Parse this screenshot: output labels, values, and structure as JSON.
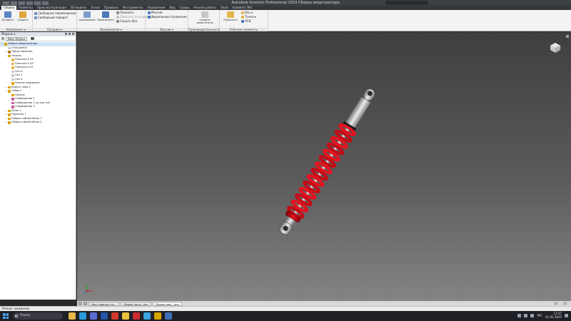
{
  "window": {
    "title": "Autodesk Inventor Professional 2019   Сборка амортизатора"
  },
  "ribbon_tabs": [
    {
      "label": "Сборка",
      "active": true
    },
    {
      "label": "Разметка"
    },
    {
      "label": "Пров.эксплуатация"
    },
    {
      "label": "3D-модель"
    },
    {
      "label": "Эскиз"
    },
    {
      "label": "Проверка"
    },
    {
      "label": "Инструменты"
    },
    {
      "label": "Управление"
    },
    {
      "label": "Вид"
    },
    {
      "label": "Среды"
    },
    {
      "label": "Начало работы"
    },
    {
      "label": "Vault"
    },
    {
      "label": "Autodesk 360"
    }
  ],
  "ribbon": {
    "groups": [
      {
        "label": "Компонент ▾"
      },
      {
        "label": "Позиция ▾"
      },
      {
        "label": "Взаимосвязи ▾"
      },
      {
        "label": "Массив ▾"
      },
      {
        "label": "Производительность"
      },
      {
        "label": "Рабочие элементы"
      }
    ],
    "insert": "Вставить",
    "create": "Создать",
    "free_move": "Свободное перемещение",
    "free_rotate": "Свободный поворот",
    "assemble": "Сопряжение",
    "constrain": "Зависимость",
    "show": "Показать",
    "show_all": "Показать Ассоциацию",
    "hide_all": "Скрыть Все",
    "pattern": "Массив",
    "mirror": "Зеркальное отражение",
    "create_subst": "Создать заместитель",
    "plane": "Плоскость",
    "axis": "Ось ▾",
    "point": "Точка ▾",
    "ucs": "ПСК"
  },
  "browser": {
    "title": "Модель ▾",
    "view_selector": "Вид сборки",
    "tree": [
      {
        "label": "Сборка амортизатора",
        "indent": 0,
        "color": "#d9a400",
        "exp": "-",
        "selected": true
      },
      {
        "label": "Отношения",
        "indent": 1,
        "color": "#c8c8c8",
        "exp": ""
      },
      {
        "label": "Представления",
        "indent": 1,
        "color": "#b07a28",
        "exp": "+"
      },
      {
        "label": "Начало",
        "indent": 1,
        "color": "#d9a400",
        "exp": "-"
      },
      {
        "label": "Плоскость YZ",
        "indent": 2,
        "color": "#e9b84a",
        "exp": ""
      },
      {
        "label": "Плоскость XZ",
        "indent": 2,
        "color": "#e9b84a",
        "exp": ""
      },
      {
        "label": "Плоскость XY",
        "indent": 2,
        "color": "#e9b84a",
        "exp": ""
      },
      {
        "label": "Ось X",
        "indent": 2,
        "color": "#c8c8c8",
        "exp": ""
      },
      {
        "label": "Ось Y",
        "indent": 2,
        "color": "#c8c8c8",
        "exp": ""
      },
      {
        "label": "Ось Z",
        "indent": 2,
        "color": "#c8c8c8",
        "exp": ""
      },
      {
        "label": "Начало координат",
        "indent": 2,
        "color": "#d9a400",
        "exp": ""
      },
      {
        "label": "Корпус лево 1",
        "indent": 1,
        "color": "#d9a400",
        "exp": "+"
      },
      {
        "label": "Гайка 1",
        "indent": 1,
        "color": "#d9a400",
        "exp": "-"
      },
      {
        "label": "Начало",
        "indent": 2,
        "color": "#d9a400",
        "exp": ""
      },
      {
        "label": "Совмещение 1",
        "indent": 2,
        "color": "#c85b9c",
        "exp": ""
      },
      {
        "label": "Совмещение 2 (углов. ed)",
        "indent": 2,
        "color": "#c85b9c",
        "exp": ""
      },
      {
        "label": "Совмещение 3",
        "indent": 2,
        "color": "#c85b9c",
        "exp": ""
      },
      {
        "label": "Шток 1",
        "indent": 1,
        "color": "#d9a400",
        "exp": "+"
      },
      {
        "label": "Пружина 1",
        "indent": 1,
        "color": "#d9a400",
        "exp": "+"
      },
      {
        "label": "Сборка сайлентблок 1",
        "indent": 1,
        "color": "#d9a400",
        "exp": "+"
      },
      {
        "label": "Сборка сайлентблок 2",
        "indent": 1,
        "color": "#d9a400",
        "exp": "+"
      }
    ]
  },
  "doc_tabs": [
    {
      "label": "Мои главная стр..."
    },
    {
      "label": "Сборка пруж...iam"
    },
    {
      "label": "Сборка амо....iam",
      "active": true
    }
  ],
  "doc_counts": [
    "13",
    "15"
  ],
  "status": {
    "text": "Режим: ожидание"
  },
  "taskbar": {
    "search": "Поиск",
    "apps": [
      {
        "name": "file-explorer-icon",
        "color": "#e8b94a"
      },
      {
        "name": "edge-icon",
        "color": "#2b9be0"
      },
      {
        "name": "store-icon",
        "color": "#5b6bd6"
      },
      {
        "name": "photoshop-icon",
        "color": "#2255a8"
      },
      {
        "name": "pdf-icon",
        "color": "#d23a2e"
      },
      {
        "name": "chrome-icon",
        "color": "#eac13a"
      },
      {
        "name": "opera-icon",
        "color": "#cc2b2b"
      },
      {
        "name": "telegram-icon",
        "color": "#3aa4e0"
      },
      {
        "name": "inventor-icon",
        "color": "#d9a400"
      },
      {
        "name": "word-icon",
        "color": "#3f6fb5"
      }
    ],
    "lang": "РУС",
    "time": "13:37",
    "date": "01.05.2025"
  }
}
